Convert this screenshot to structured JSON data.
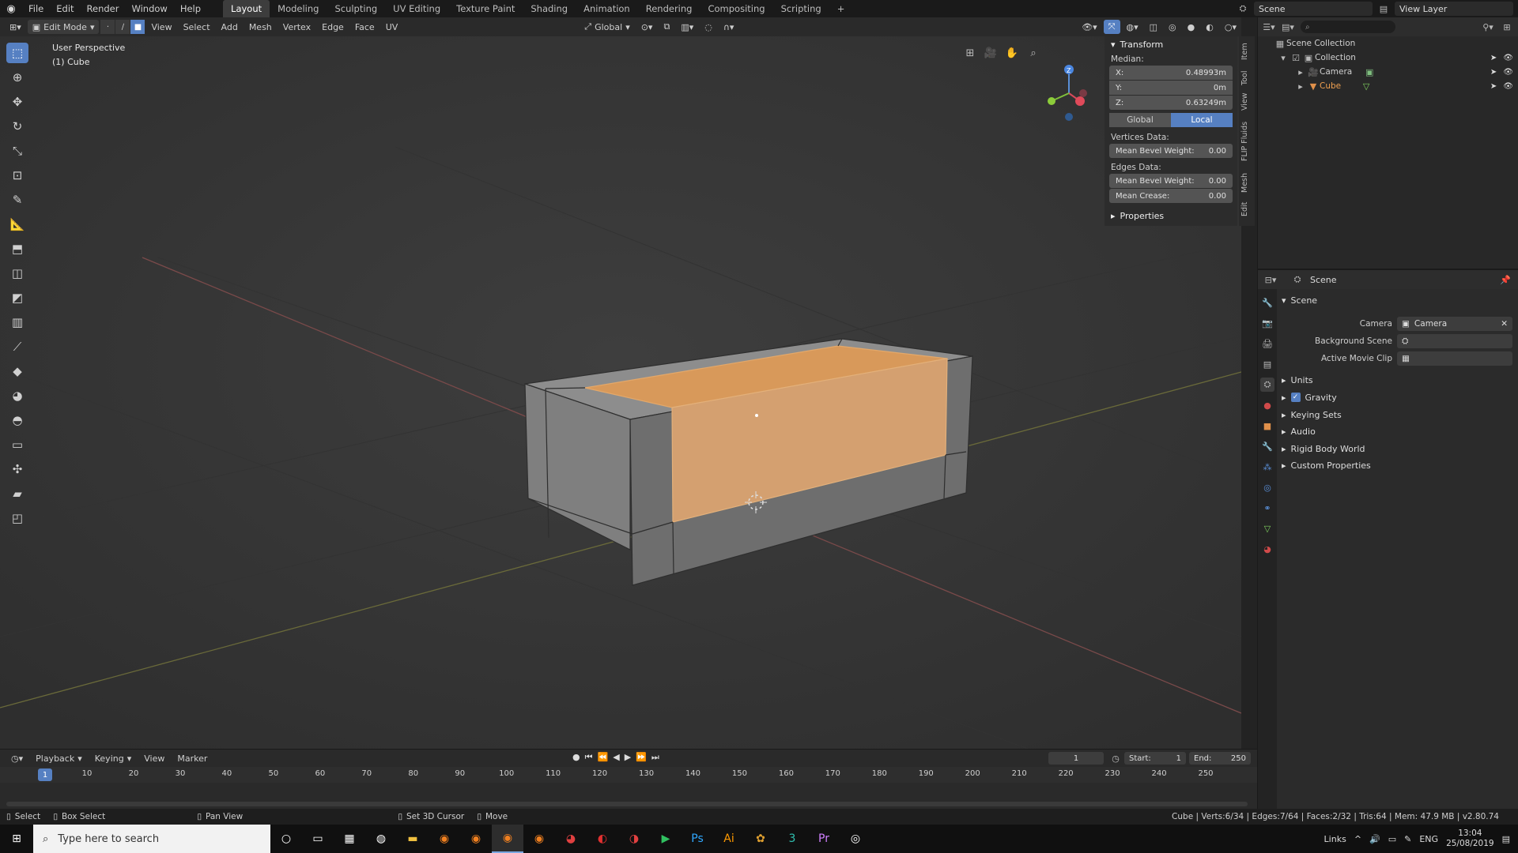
{
  "menu": [
    "File",
    "Edit",
    "Render",
    "Window",
    "Help"
  ],
  "workspaces": [
    "Layout",
    "Modeling",
    "Sculpting",
    "UV Editing",
    "Texture Paint",
    "Shading",
    "Animation",
    "Rendering",
    "Compositing",
    "Scripting"
  ],
  "active_workspace": "Layout",
  "scene_name": "Scene",
  "view_layer": "View Layer",
  "viewport_header": {
    "mode": "Edit Mode",
    "menus": [
      "View",
      "Select",
      "Add",
      "Mesh",
      "Vertex",
      "Edge",
      "Face",
      "UV"
    ],
    "orientation": "Global"
  },
  "viewport": {
    "perspective": "User Perspective",
    "object": "(1) Cube"
  },
  "npanel": {
    "transform_title": "Transform",
    "median_label": "Median:",
    "x_label": "X:",
    "x_value": "0.48993m",
    "y_label": "Y:",
    "y_value": "0m",
    "z_label": "Z:",
    "z_value": "0.63249m",
    "global": "Global",
    "local": "Local",
    "vertices_data": "Vertices Data:",
    "mean_bevel_weight_label": "Mean Bevel Weight:",
    "vertex_bevel_value": "0.00",
    "edges_data": "Edges Data:",
    "edge_bevel_value": "0.00",
    "mean_crease_label": "Mean Crease:",
    "mean_crease_value": "0.00",
    "properties_title": "Properties",
    "tabs": [
      "Item",
      "Tool",
      "View",
      "FLIP Fluids",
      "Mesh",
      "Edit"
    ]
  },
  "outliner": {
    "scene_collection": "Scene Collection",
    "collection": "Collection",
    "camera": "Camera",
    "cube": "Cube"
  },
  "properties": {
    "header": "Scene",
    "section": "Scene",
    "camera_label": "Camera",
    "camera_value": "Camera",
    "background_scene_label": "Background Scene",
    "active_movie_clip_label": "Active Movie Clip",
    "sections": [
      "Units",
      "Gravity",
      "Keying Sets",
      "Audio",
      "Rigid Body World",
      "Custom Properties"
    ]
  },
  "timeline": {
    "menus": [
      "Playback",
      "Keying",
      "View",
      "Marker"
    ],
    "current_frame": "1",
    "start_label": "Start:",
    "start_value": "1",
    "end_label": "End:",
    "end_value": "250",
    "ticks": [
      "1",
      "10",
      "20",
      "30",
      "40",
      "50",
      "60",
      "70",
      "80",
      "90",
      "100",
      "110",
      "120",
      "130",
      "140",
      "150",
      "160",
      "170",
      "180",
      "190",
      "200",
      "210",
      "220",
      "230",
      "240",
      "250"
    ]
  },
  "statusbar": {
    "select": "Select",
    "box_select": "Box Select",
    "pan_view": "Pan View",
    "set_3d_cursor": "Set 3D Cursor",
    "move": "Move",
    "stats": "Cube | Verts:6/34 | Edges:7/64 | Faces:2/32 | Tris:64 | Mem: 47.9 MB | v2.80.74"
  },
  "taskbar": {
    "search_placeholder": "Type here to search",
    "links": "Links",
    "lang": "ENG",
    "time": "13:04",
    "date": "25/08/2019"
  },
  "colors": {
    "accent": "#5680c2",
    "selected_face": "#d8995a",
    "mesh": "#7a7a7a"
  }
}
